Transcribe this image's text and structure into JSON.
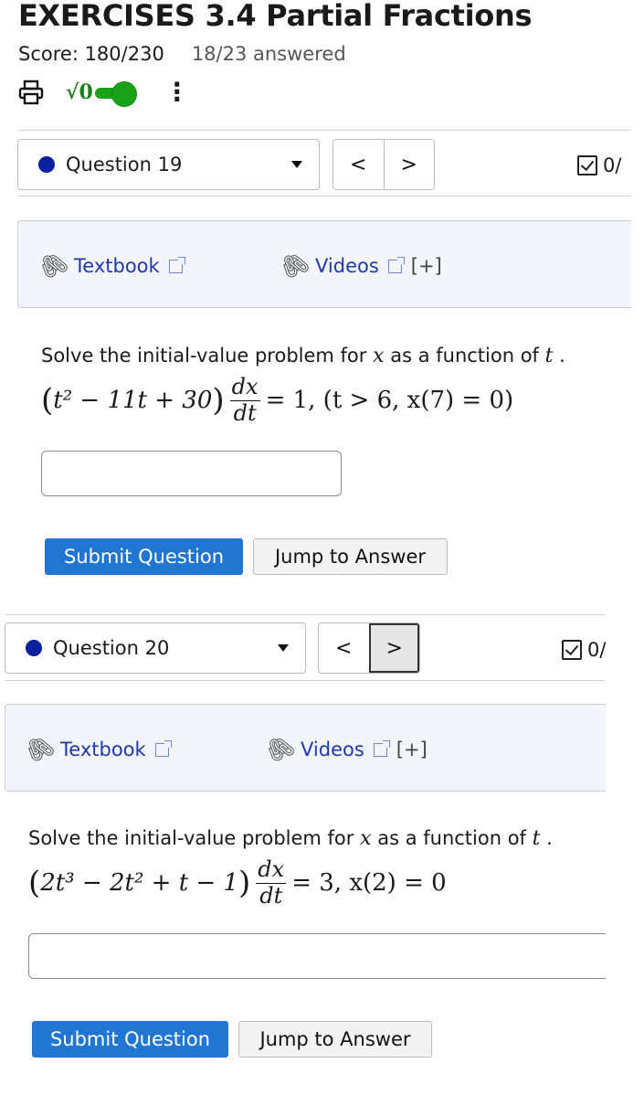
{
  "header": {
    "title": "EXERCISES 3.4 Partial Fractions",
    "score": "Score: 180/230",
    "answered": "18/23 answered",
    "math_toggle_label": "√0"
  },
  "questions": [
    {
      "label": "Question 19",
      "prev": "<",
      "next": ">",
      "score": "0/",
      "textbook": "Textbook",
      "videos": "Videos",
      "expand": "[+]",
      "prompt_pre": "Solve the initial-value problem for",
      "prompt_var": "x",
      "prompt_mid": "as a function of",
      "prompt_var2": "t",
      "prompt_end": ".",
      "eq_lhs_open": "(",
      "eq_lhs_inner": "t² − 11t + 30",
      "eq_lhs_close": ")",
      "eq_frac_num": "dx",
      "eq_frac_den": "dt",
      "eq_rhs": "= 1, (t > 6, x(7) = 0)",
      "answer_value": "",
      "submit": "Submit Question",
      "jump": "Jump to Answer"
    },
    {
      "label": "Question 20",
      "prev": "<",
      "next": ">",
      "score": "0/",
      "textbook": "Textbook",
      "videos": "Videos",
      "expand": "[+]",
      "prompt_pre": "Solve the initial-value problem for",
      "prompt_var": "x",
      "prompt_mid": "as a function of",
      "prompt_var2": "t",
      "prompt_end": ".",
      "eq_lhs_open": "(",
      "eq_lhs_inner": "2t³ − 2t² + t − 1",
      "eq_lhs_close": ")",
      "eq_frac_num": "dx",
      "eq_frac_den": "dt",
      "eq_rhs": "= 3, x(2) = 0",
      "answer_value": "",
      "submit": "Submit Question",
      "jump": "Jump to Answer"
    }
  ],
  "colors": {
    "primary_button": "#2176d2",
    "question_dot": "#0b1fa1",
    "toggle_on": "#1aa31a",
    "link": "#1c3aa9"
  }
}
